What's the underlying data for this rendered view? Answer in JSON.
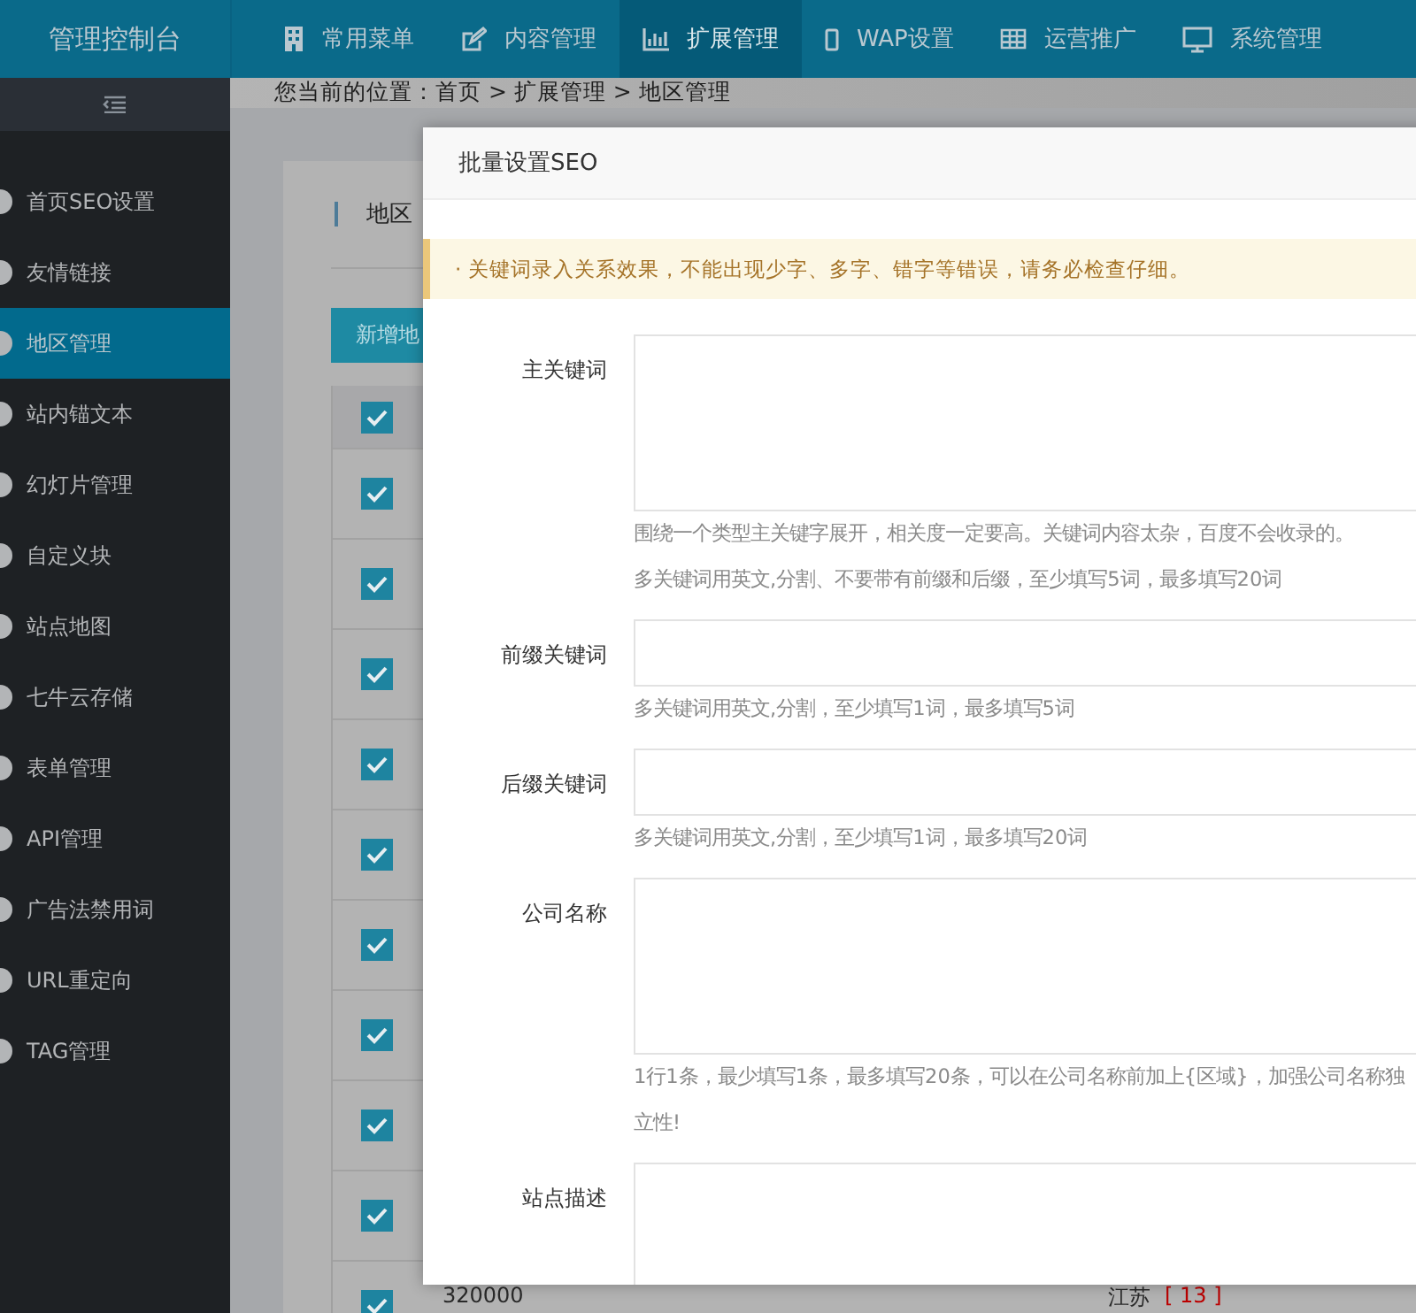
{
  "header": {
    "title": "管理控制台",
    "nav": [
      {
        "label": "常用菜单",
        "selected": false
      },
      {
        "label": "内容管理",
        "selected": false
      },
      {
        "label": "扩展管理",
        "selected": true
      },
      {
        "label": "WAP设置",
        "selected": false
      },
      {
        "label": "运营推广",
        "selected": false
      },
      {
        "label": "系统管理",
        "selected": false
      }
    ]
  },
  "sidebar": {
    "items": [
      {
        "label": "首页SEO设置",
        "selected": false
      },
      {
        "label": "友情链接",
        "selected": false
      },
      {
        "label": "地区管理",
        "selected": true
      },
      {
        "label": "站内锚文本",
        "selected": false
      },
      {
        "label": "幻灯片管理",
        "selected": false
      },
      {
        "label": "自定义块",
        "selected": false
      },
      {
        "label": "站点地图",
        "selected": false
      },
      {
        "label": "七牛云存储",
        "selected": false
      },
      {
        "label": "表单管理",
        "selected": false
      },
      {
        "label": "API管理",
        "selected": false
      },
      {
        "label": "广告法禁用词",
        "selected": false
      },
      {
        "label": "URL重定向",
        "selected": false
      },
      {
        "label": "TAG管理",
        "selected": false
      }
    ]
  },
  "breadcrumb": "您当前的位置：首页 > 扩展管理 > 地区管理",
  "card": {
    "title": "地区",
    "button": "新增地",
    "header_checked": true,
    "rows": [
      {
        "checked": true
      },
      {
        "checked": true
      },
      {
        "checked": true
      },
      {
        "checked": true
      },
      {
        "checked": true
      },
      {
        "checked": true
      },
      {
        "checked": true
      },
      {
        "checked": true
      },
      {
        "checked": true
      },
      {
        "checked": true,
        "code": "320000",
        "name": "江苏",
        "count": "[ 13 ]"
      }
    ]
  },
  "dialog": {
    "title": "批量设置SEO",
    "notice": "· 关键词录入关系效果，不能出现少字、多字、错字等错误，请务必检查仔细。",
    "fields": [
      {
        "label": "主关键词",
        "kind": "textarea",
        "hints": [
          "围绕一个类型主关键字展开，相关度一定要高。关键词内容太杂，百度不会收录的。",
          "多关键词用英文,分割、不要带有前缀和后缀，至少填写5词，最多填写20词"
        ]
      },
      {
        "label": "前缀关键词",
        "kind": "input",
        "hints": [
          "多关键词用英文,分割，至少填写1词，最多填写5词"
        ]
      },
      {
        "label": "后缀关键词",
        "kind": "input",
        "hints": [
          "多关键词用英文,分割，至少填写1词，最多填写20词"
        ]
      },
      {
        "label": "公司名称",
        "kind": "textarea",
        "hints": [
          "1行1条，最少填写1条，最多填写20条，可以在公司名称前加上{区域}，加强公司名称独立性!"
        ]
      },
      {
        "label": "站点描述",
        "kind": "textarea"
      }
    ]
  }
}
